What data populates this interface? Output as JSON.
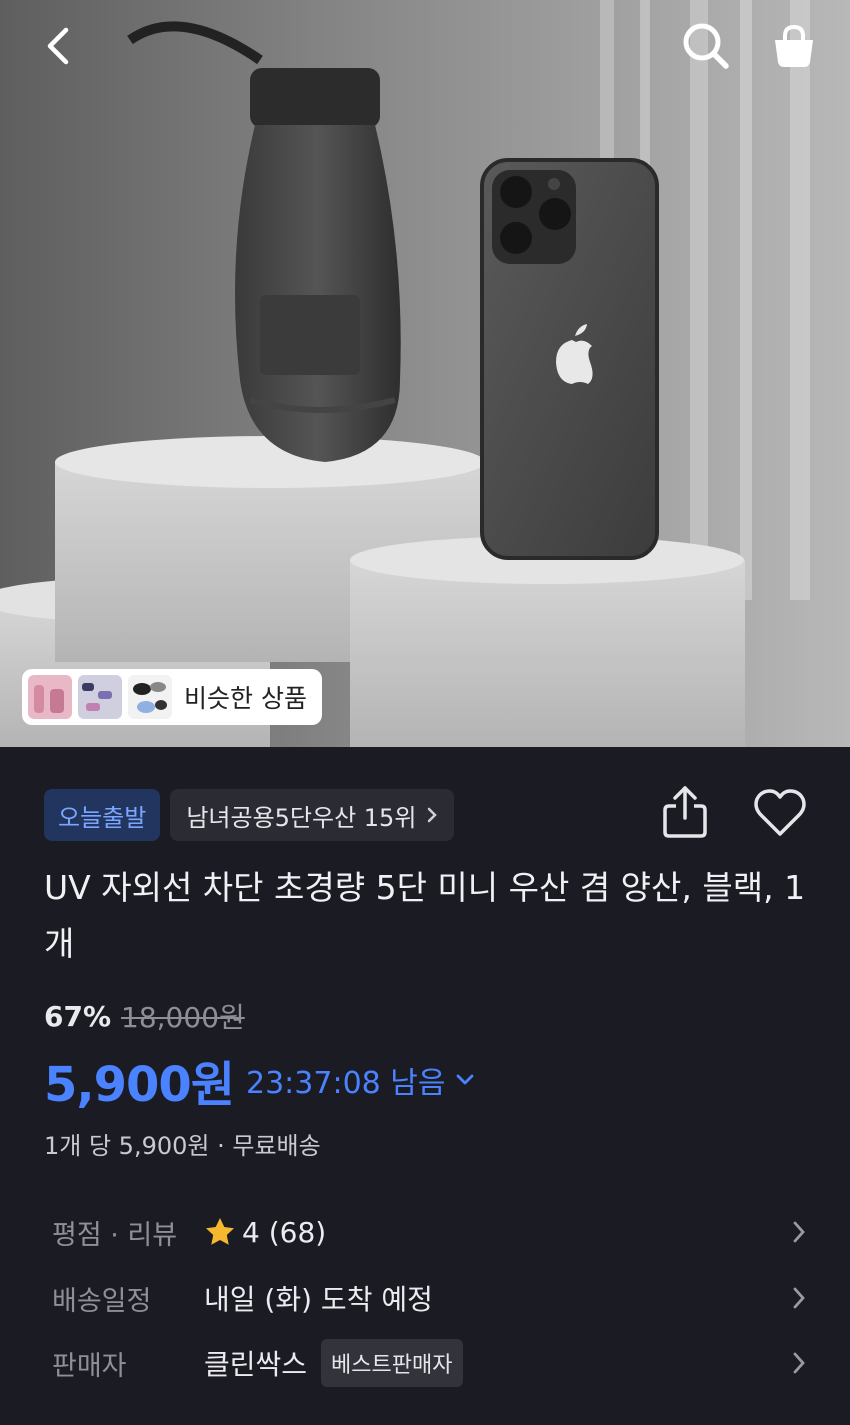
{
  "header": {
    "back_icon": "chevron-left-icon",
    "search_icon": "search-icon",
    "cart_icon": "shopping-bag-icon"
  },
  "hero": {
    "similar_products_label": "비슷한 상품"
  },
  "product": {
    "badge_today": "오늘출발",
    "rank_badge": "남녀공용5단우산 15위",
    "title": "UV 자외선 차단 초경량 5단 미니 우산 겸 양산, 블랙, 1개",
    "discount": "67%",
    "original_price": "18,000원",
    "price": "5,900원",
    "timer": "23:37:08 남음",
    "unit_shipping": "1개 당 5,900원 · 무료배송"
  },
  "details": {
    "rating_label": "평점 · 리뷰",
    "rating_value": "4 (68)",
    "delivery_label": "배송일정",
    "delivery_value": "내일 (화) 도착 예정",
    "seller_label": "판매자",
    "seller_name": "클린싹스",
    "seller_badge": "베스트판매자"
  },
  "colors": {
    "background": "#1b1b24",
    "accent_blue": "#4a82ff",
    "today_badge_bg": "#22355e",
    "star": "#f5b82e"
  }
}
